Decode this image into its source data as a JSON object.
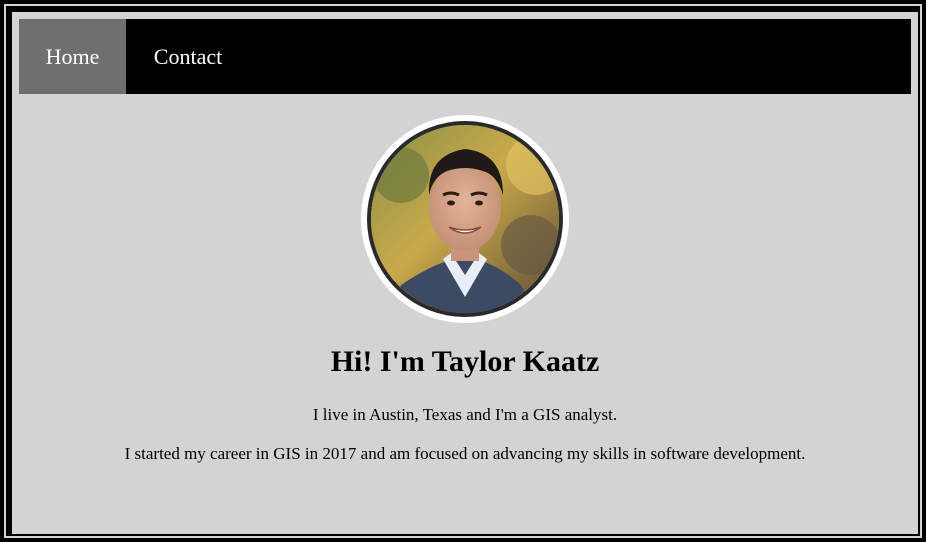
{
  "nav": {
    "items": [
      {
        "label": "Home",
        "active": true
      },
      {
        "label": "Contact",
        "active": false
      }
    ]
  },
  "profile": {
    "photo": "profile-photo"
  },
  "main": {
    "heading": "Hi! I'm Taylor Kaatz",
    "intro": "I live in Austin, Texas and I'm a GIS analyst.",
    "career": "I started my career in GIS in 2017 and am focused on advancing my skills in software development."
  },
  "colors": {
    "page_background": "#d3d3d3",
    "navbar_background": "#000000",
    "nav_active_background": "#6f6f6f",
    "nav_text": "#ffffff"
  }
}
